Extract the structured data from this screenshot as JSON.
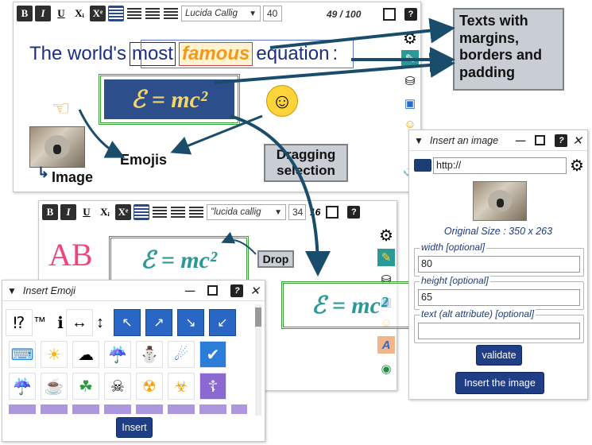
{
  "editor1": {
    "font_name": "Lucida Callig",
    "font_size": "40",
    "char_count": "49 / 100",
    "sentence_words": [
      "The world's",
      "most",
      "famous",
      "equation",
      ":"
    ],
    "equation": "ℰ = mc²",
    "image_label": "Image",
    "emoji_label": "Emojis"
  },
  "toolbar_glyphs": {
    "bold": "B",
    "italic": "I",
    "underline": "U",
    "subscript": "Xᵢ",
    "superscript": "Xᵉ",
    "help": "?"
  },
  "callouts": {
    "texts": "Texts with margins, borders and padding",
    "dragging": "Dragging selection",
    "drop": "Drop"
  },
  "editor2": {
    "font_name": "\"lucida callig",
    "font_size": "34",
    "char_count": "16",
    "ab_text": "AB",
    "equation": "ℰ = mc²"
  },
  "insert_emoji": {
    "title": "Insert Emoji",
    "insert_label": "Insert",
    "row1": [
      "⁉",
      "™",
      "ℹ",
      "↔",
      "↕"
    ],
    "row1_arrows": [
      "↖",
      "↗",
      "↘",
      "↙"
    ],
    "row2": [
      "⌨",
      "☀",
      "☁",
      "☔",
      "⛄",
      "☄",
      "✔"
    ],
    "row3": [
      "☔",
      "☕",
      "☘",
      "☠",
      "☢",
      "☣",
      "☦"
    ]
  },
  "insert_image": {
    "title": "Insert an image",
    "url_value": "http://",
    "original_size": "Original Size : 350 x 263",
    "width_label": "width [optional]",
    "width_value": "80",
    "height_label": "height [optional]",
    "height_value": "65",
    "alt_label": "text (alt attribute) [optional]",
    "alt_value": "",
    "validate_label": "validate",
    "insert_label": "Insert the image"
  },
  "window_controls": {
    "collapse": "▼",
    "minimize": "—",
    "maximize": "▢",
    "help": "?",
    "close": "✕"
  },
  "colors": {
    "accent_blue": "#1f3e86",
    "equation_bg": "#2c4e8a",
    "green_frame": "#3aa13a",
    "teal_eq": "#2a9a96",
    "pink_ab": "#f0457a",
    "callout_bg": "#c9ced4",
    "famous_orange": "#f19a1a"
  }
}
